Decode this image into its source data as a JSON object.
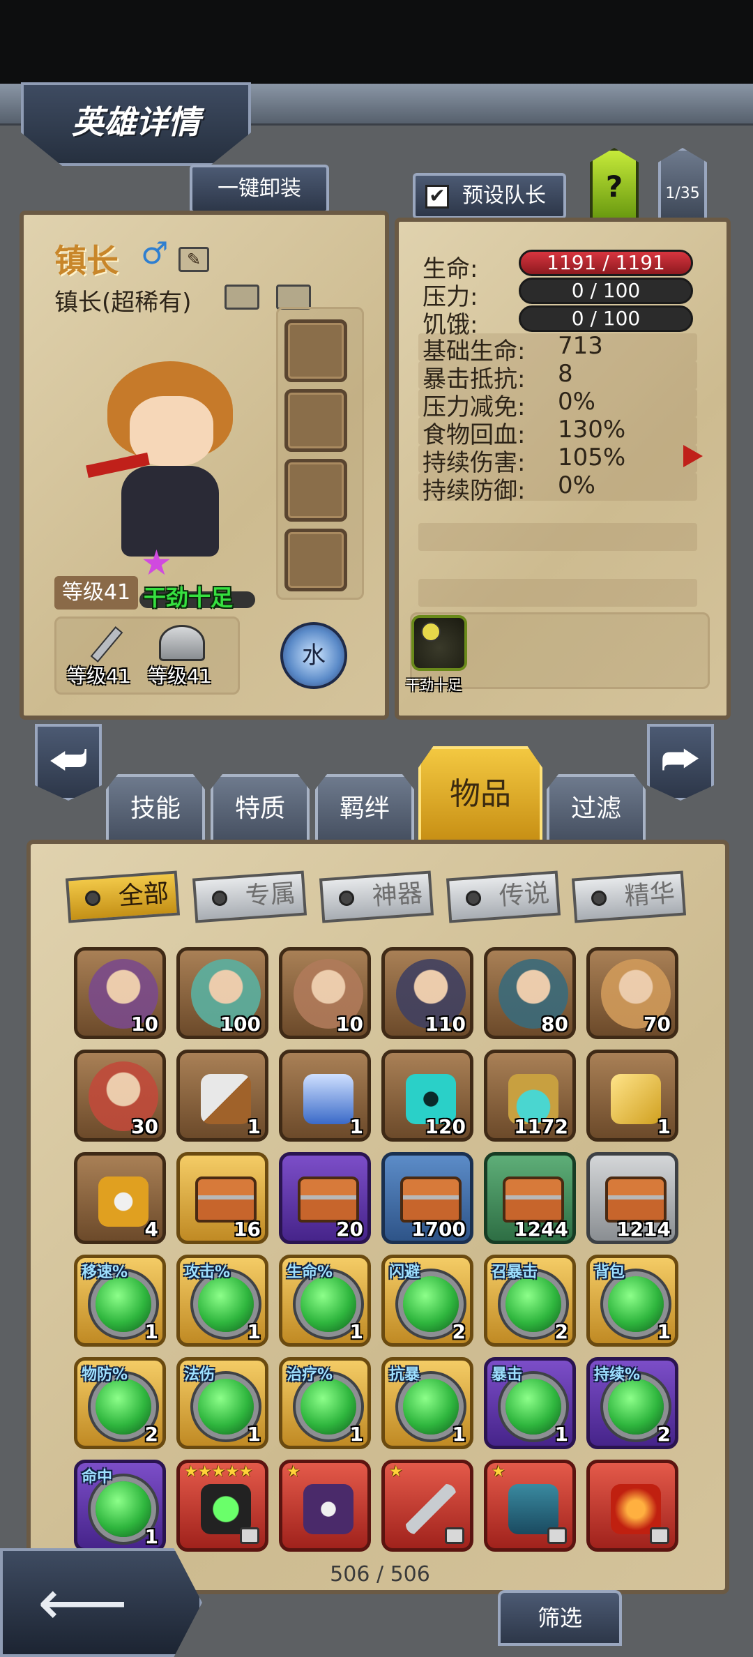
{
  "header": {
    "title": "英雄详情"
  },
  "top_buttons": {
    "unequip_all": "一键卸装",
    "preset_leader": "预设队长",
    "help": "?",
    "page_counter": "1/35"
  },
  "hero": {
    "name": "镇长",
    "gender_symbol": "♂",
    "subtitle": "镇长(超稀有)",
    "level": "等级41",
    "buff_label": "干劲十足",
    "weapon_level": "等级41",
    "armor_level": "等级41",
    "element": "水"
  },
  "stats": {
    "hp_label": "生命:",
    "hp_value": "1191 / 1191",
    "stress_label": "压力:",
    "stress_value": "0 / 100",
    "hunger_label": "饥饿:",
    "hunger_value": "0 / 100",
    "rows": [
      {
        "label": "基础生命:",
        "value": "713"
      },
      {
        "label": "暴击抵抗:",
        "value": "8"
      },
      {
        "label": "压力减免:",
        "value": "0%"
      },
      {
        "label": "食物回血:",
        "value": "130%"
      },
      {
        "label": "持续伤害:",
        "value": "105%"
      },
      {
        "label": "持续防御:",
        "value": "0%"
      }
    ],
    "status_icon_label": "干劲十足"
  },
  "tabs": [
    "技能",
    "特质",
    "羁绊",
    "物品",
    "过滤"
  ],
  "filters": [
    "全部",
    "专属",
    "神器",
    "传说",
    "精华"
  ],
  "items": [
    {
      "type": "hero",
      "count": "10",
      "color": "#7a4a8a"
    },
    {
      "type": "hero",
      "count": "100",
      "color": "#5ab0a0"
    },
    {
      "type": "hero",
      "count": "10",
      "color": "#b07a5a"
    },
    {
      "type": "hero",
      "count": "110",
      "color": "#404060"
    },
    {
      "type": "hero",
      "count": "80",
      "color": "#3a6a7a"
    },
    {
      "type": "hero",
      "count": "70",
      "color": "#d09a5a"
    },
    {
      "type": "hero",
      "count": "30",
      "color": "#c04a3a"
    },
    {
      "type": "material",
      "count": "1",
      "icon": "knife-icon"
    },
    {
      "type": "material",
      "count": "1",
      "icon": "powder-pile-icon"
    },
    {
      "type": "material",
      "count": "120",
      "icon": "teal-rune-icon"
    },
    {
      "type": "material",
      "count": "1172",
      "icon": "potion-bottle-icon"
    },
    {
      "type": "material",
      "count": "1",
      "icon": "golden-ticket-icon"
    },
    {
      "type": "material",
      "count": "4",
      "icon": "skull-scroll-icon"
    },
    {
      "type": "chest",
      "count": "16",
      "rarity": "gold"
    },
    {
      "type": "chest",
      "count": "20",
      "rarity": "purple"
    },
    {
      "type": "chest",
      "count": "1700",
      "rarity": "blue"
    },
    {
      "type": "chest",
      "count": "1244",
      "rarity": "green"
    },
    {
      "type": "chest",
      "count": "1214",
      "rarity": "silver"
    },
    {
      "type": "rune",
      "tag": "移速%",
      "count": "1",
      "rarity": "gold"
    },
    {
      "type": "rune",
      "tag": "攻击%",
      "count": "1",
      "rarity": "gold"
    },
    {
      "type": "rune",
      "tag": "生命%",
      "count": "1",
      "rarity": "gold"
    },
    {
      "type": "rune",
      "tag": "闪避",
      "count": "2",
      "rarity": "gold"
    },
    {
      "type": "rune",
      "tag": "召暴击",
      "count": "2",
      "rarity": "gold"
    },
    {
      "type": "rune",
      "tag": "背包",
      "count": "1",
      "rarity": "gold"
    },
    {
      "type": "rune",
      "tag": "物防%",
      "count": "2",
      "rarity": "gold"
    },
    {
      "type": "rune",
      "tag": "法伤",
      "count": "1",
      "rarity": "gold"
    },
    {
      "type": "rune",
      "tag": "治疗%",
      "count": "1",
      "rarity": "gold"
    },
    {
      "type": "rune",
      "tag": "抗暴",
      "count": "1",
      "rarity": "gold"
    },
    {
      "type": "rune",
      "tag": "暴击",
      "count": "1",
      "rarity": "purple"
    },
    {
      "type": "rune",
      "tag": "持续%",
      "count": "2",
      "rarity": "purple"
    },
    {
      "type": "rune",
      "tag": "命中",
      "count": "1",
      "rarity": "purple"
    },
    {
      "type": "relic",
      "stars": "★★★★★",
      "icon": "green-orb-icon",
      "locked": true
    },
    {
      "type": "relic",
      "stars": "★",
      "icon": "skull-cloak-icon",
      "locked": false
    },
    {
      "type": "relic",
      "stars": "★",
      "icon": "sniper-rifle-icon",
      "locked": true
    },
    {
      "type": "relic",
      "stars": "★",
      "icon": "spell-book-icon",
      "locked": true
    },
    {
      "type": "relic",
      "stars": "",
      "icon": "flame-heart-icon",
      "locked": true
    }
  ],
  "footer": {
    "item_count": "506 / 506",
    "filter_button": "筛选"
  }
}
